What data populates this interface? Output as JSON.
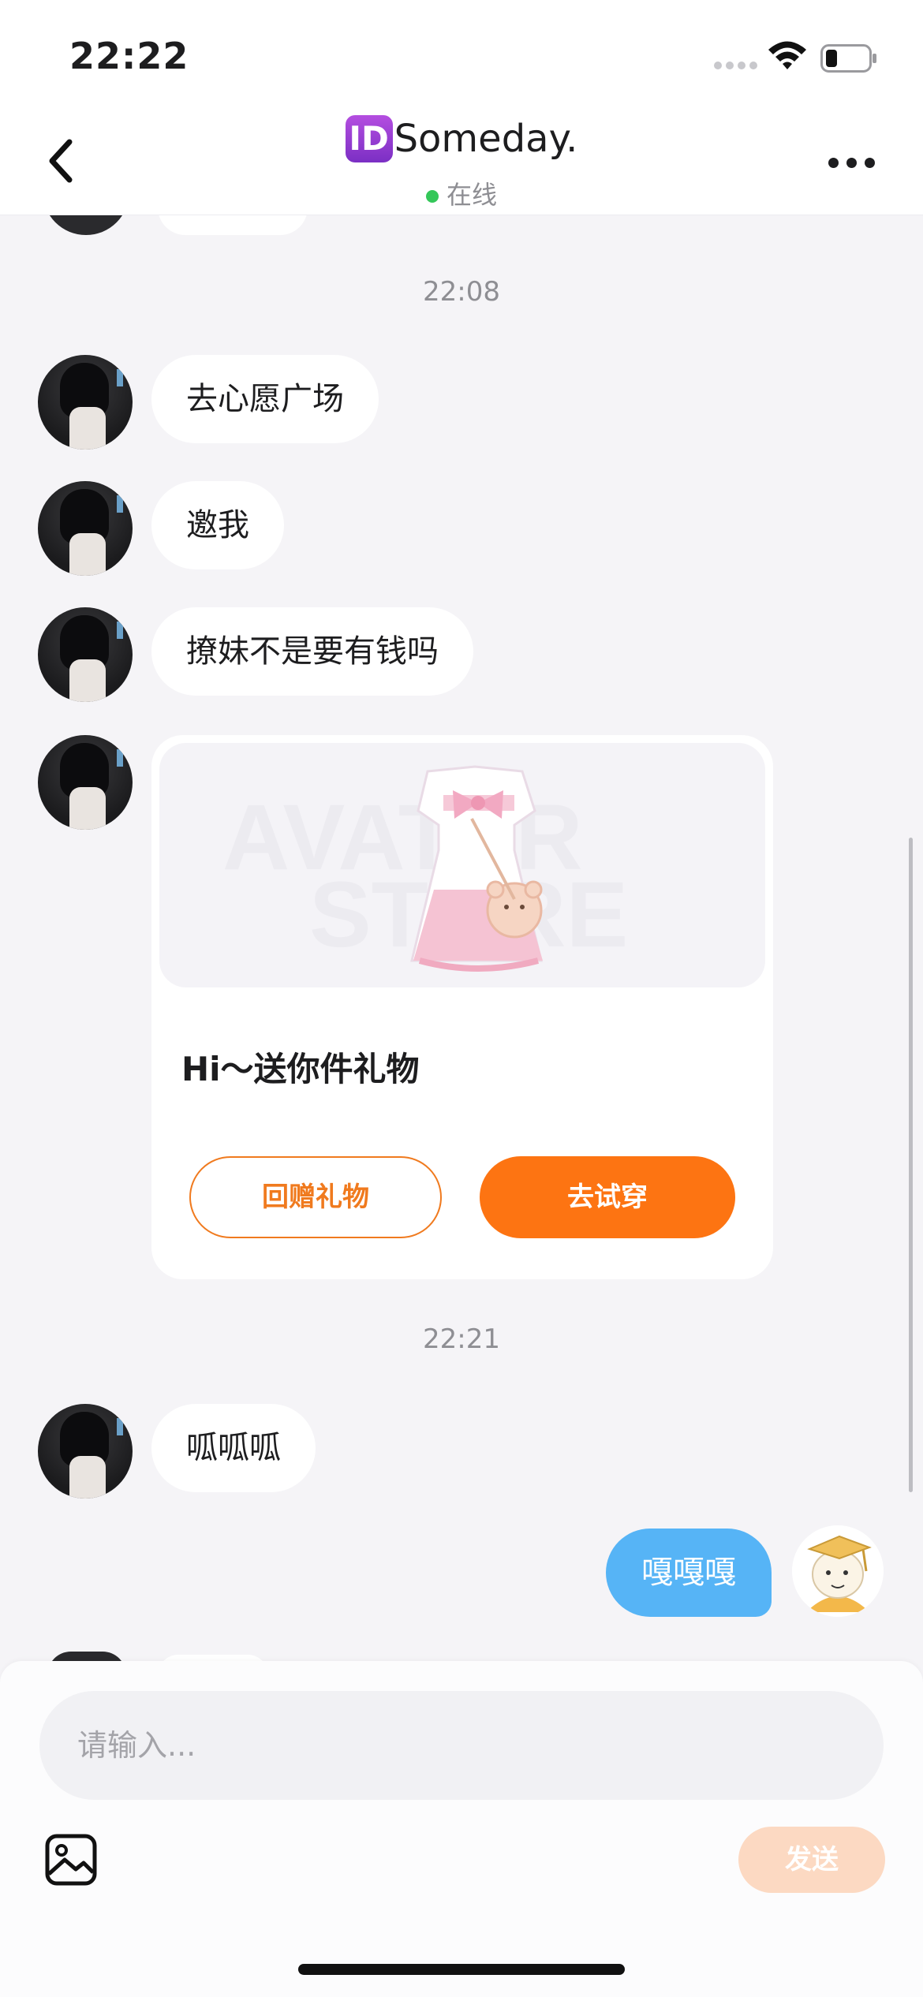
{
  "status_bar": {
    "time": "22:22"
  },
  "header": {
    "badge": "ID",
    "title": "Someday.",
    "status": "在线"
  },
  "messages": [
    {
      "type": "timestamp",
      "text": "22:08"
    },
    {
      "type": "incoming",
      "text": "去心愿广场"
    },
    {
      "type": "incoming",
      "text": "邀我"
    },
    {
      "type": "incoming",
      "text": "撩妹不是要有钱吗"
    },
    {
      "type": "gift_card",
      "title": "Hi～送你件礼物",
      "return_button": "回赠礼物",
      "try_button": "去试穿",
      "watermark": [
        "AVATAR",
        "STORE"
      ]
    },
    {
      "type": "timestamp",
      "text": "22:21"
    },
    {
      "type": "incoming",
      "text": "呱呱呱"
    },
    {
      "type": "outgoing",
      "text": "嘎嘎嘎"
    }
  ],
  "composer": {
    "placeholder": "请输入...",
    "send_label": "发送"
  },
  "colors": {
    "accent_orange": "#fd7412",
    "outgoing_bubble": "#56b4f6",
    "online": "#34c759",
    "send_disabled": "#fcd9c2"
  },
  "icons": [
    "back-icon",
    "more-icon",
    "image-icon",
    "wifi-icon",
    "battery-icon"
  ]
}
